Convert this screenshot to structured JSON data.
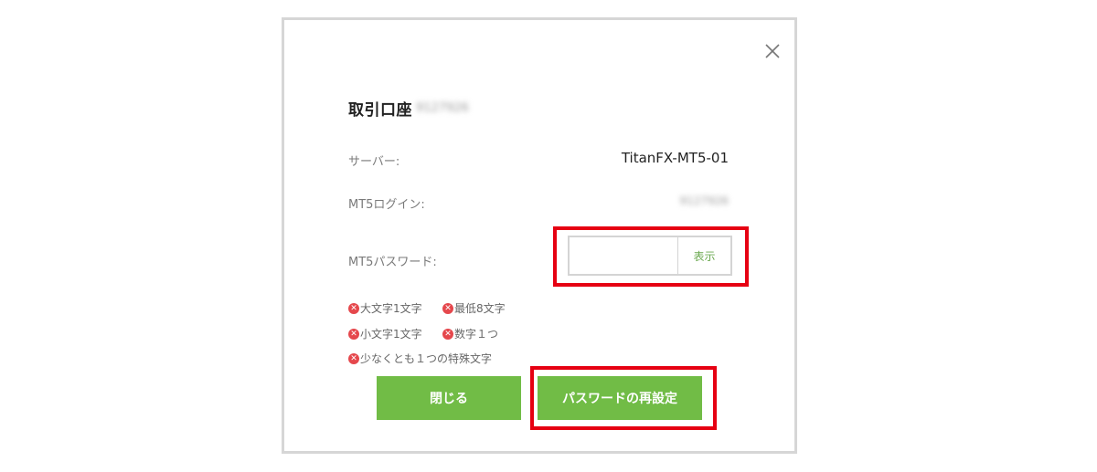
{
  "dialog": {
    "title": "取引口座",
    "account_number_masked": "9127926",
    "close_icon": "close-icon"
  },
  "server": {
    "label": "サーバー:",
    "value": "TitanFX-MT5-01"
  },
  "login": {
    "label": "MT5ログイン:",
    "value_masked": "9127926"
  },
  "password": {
    "label": "MT5パスワード:",
    "value": "",
    "show_label": "表示"
  },
  "requirements": [
    {
      "text": "大文字1文字",
      "status": "unmet"
    },
    {
      "text": "最低8文字",
      "status": "unmet"
    },
    {
      "text": "小文字1文字",
      "status": "unmet"
    },
    {
      "text": "数字１つ",
      "status": "unmet"
    },
    {
      "text": "少なくとも１つの特殊文字",
      "status": "unmet"
    }
  ],
  "buttons": {
    "close_label": "閉じる",
    "reset_label": "パスワードの再設定"
  },
  "colors": {
    "primary_green": "#71bc46",
    "error_red": "#e5474c",
    "highlight_red": "#e60012"
  }
}
